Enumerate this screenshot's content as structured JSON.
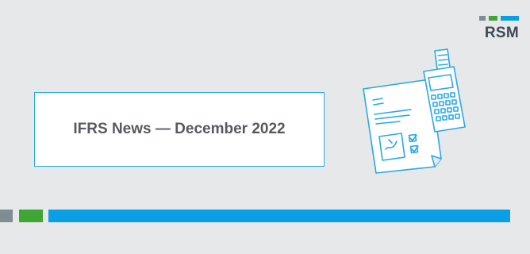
{
  "banner": {
    "title": "IFRS News — December 2022"
  },
  "logo": {
    "text": "RSM"
  },
  "colors": {
    "background": "#e7e8e9",
    "accent_blue": "#0a9fe4",
    "accent_green": "#3fa535",
    "accent_gray": "#7f8c93",
    "title_text": "#555a60",
    "logo_text": "#3f4b56"
  },
  "icons": {
    "illustration": "document-with-calculator-icon"
  }
}
